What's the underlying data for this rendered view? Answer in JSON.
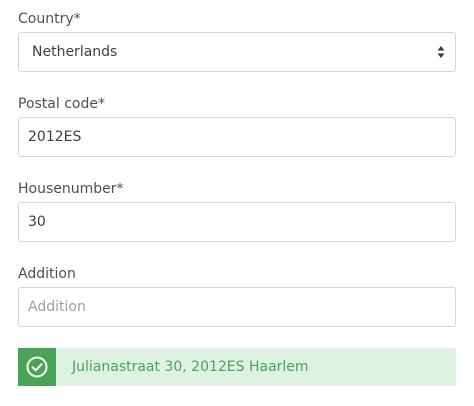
{
  "country": {
    "label": "Country*",
    "value": "Netherlands",
    "icon": "select-arrows-icon"
  },
  "postal_code": {
    "label": "Postal code*",
    "value": "2012ES"
  },
  "housenumber": {
    "label": "Housenumber*",
    "value": "30"
  },
  "addition": {
    "label": "Addition",
    "value": "",
    "placeholder": "Addition"
  },
  "address_result": {
    "icon": "check-circle-icon",
    "text": "Julianastraat 30, 2012ES Haarlem",
    "colors": {
      "background": "#dff1e2",
      "accent": "#4aa457"
    }
  }
}
